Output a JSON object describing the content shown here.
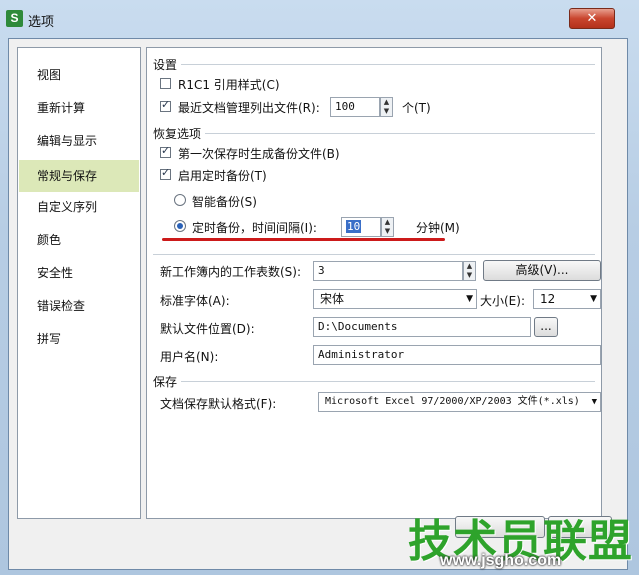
{
  "window": {
    "app_icon_letter": "S",
    "title": "选项",
    "close_glyph": "✕"
  },
  "nav": {
    "items": [
      {
        "label": "视图"
      },
      {
        "label": "重新计算"
      },
      {
        "label": "编辑与显示"
      },
      {
        "label": "常规与保存",
        "selected": true
      },
      {
        "label": "自定义序列"
      },
      {
        "label": "颜色"
      },
      {
        "label": "安全性"
      },
      {
        "label": "错误检查"
      },
      {
        "label": "拼写"
      }
    ]
  },
  "settings": {
    "section_title": "设置",
    "r1c1_label": "R1C1 引用样式(C)",
    "r1c1_checked": false,
    "recent_files_label": "最近文档管理列出文件(R):",
    "recent_files_checked": true,
    "recent_files_value": "100",
    "recent_files_unit": "个(T)"
  },
  "recovery": {
    "section_title": "恢复选项",
    "backup_first_save_label": "第一次保存时生成备份文件(B)",
    "backup_first_save_checked": true,
    "enable_timed_backup_label": "启用定时备份(T)",
    "enable_timed_backup_checked": true,
    "smart_backup_label": "智能备份(S)",
    "smart_backup_selected": false,
    "timed_backup_label": "定时备份，时间间隔(I):",
    "timed_backup_selected": true,
    "interval_value": "10",
    "interval_unit": "分钟(M)"
  },
  "general": {
    "sheets_label": "新工作簿内的工作表数(S):",
    "sheets_value": "3",
    "advanced_button": "高级(V)...",
    "font_label": "标准字体(A):",
    "font_value": "宋体",
    "size_label": "大小(E):",
    "size_value": "12",
    "location_label": "默认文件位置(D):",
    "location_value": "D:\\Documents",
    "browse_button": "...",
    "username_label": "用户名(N):",
    "username_value": "Administrator"
  },
  "save": {
    "section_title": "保存",
    "format_label": "文档保存默认格式(F):",
    "format_value": "Microsoft Excel 97/2000/XP/2003 文件(*.xls)"
  },
  "watermark": {
    "text": "技术员联盟",
    "url": "www.jsgho.com"
  },
  "colors": {
    "highlight_underline": "#cc1a1a",
    "nav_selected": "#dce8b8",
    "watermark_green": "#2ea32b"
  }
}
